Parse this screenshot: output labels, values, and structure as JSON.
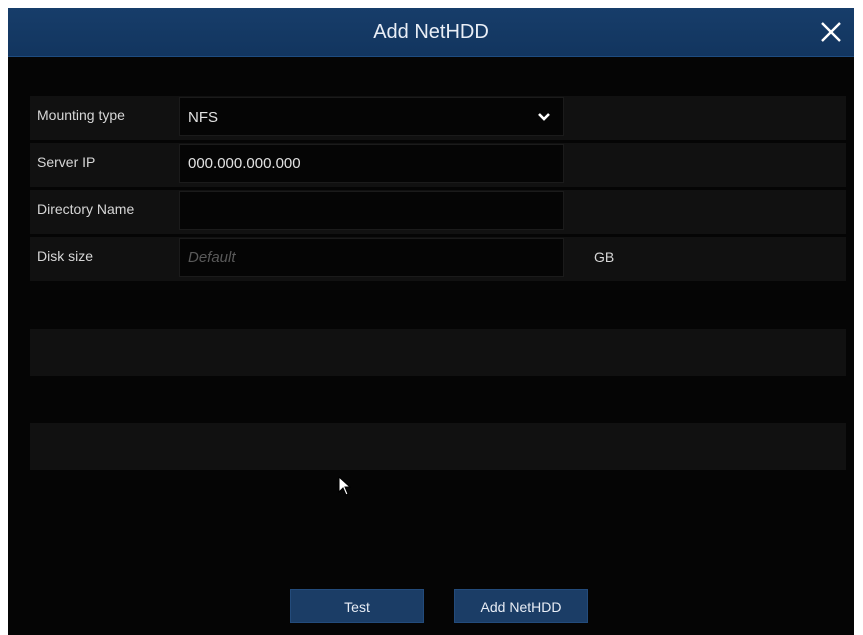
{
  "dialog": {
    "title": "Add NetHDD",
    "close_icon": "close-icon"
  },
  "form": {
    "mounting_type": {
      "label": "Mounting type",
      "value": "NFS",
      "icon": "chevron-down-icon"
    },
    "server_ip": {
      "label": "Server IP",
      "value": "000.000.000.000"
    },
    "directory_name": {
      "label": "Directory Name",
      "value": ""
    },
    "disk_size": {
      "label": "Disk size",
      "value": "",
      "placeholder": "Default",
      "unit": "GB"
    }
  },
  "buttons": {
    "test": "Test",
    "add": "Add NetHDD"
  },
  "colors": {
    "background": "#050505",
    "titlebar": "#173d6a",
    "row": "#111111",
    "button": "#1b3d66"
  }
}
